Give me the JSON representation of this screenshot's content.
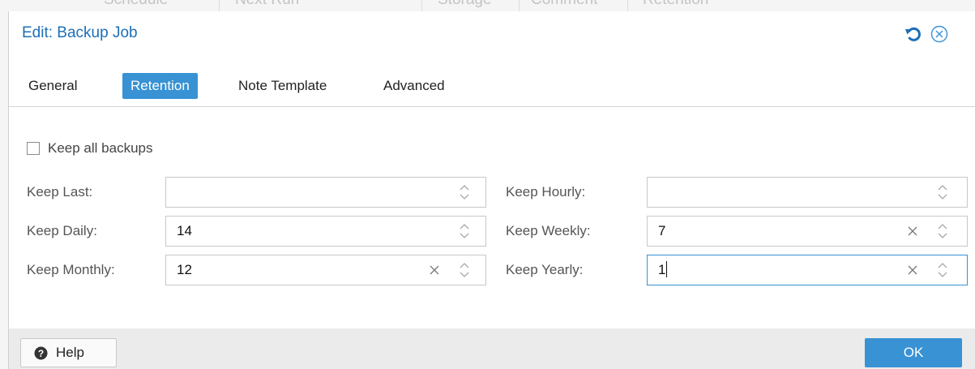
{
  "background": {
    "columns": [
      "Schedule",
      "Next Run",
      "Storage",
      "Comment",
      "Retention"
    ]
  },
  "dialog": {
    "title": "Edit: Backup Job",
    "tools": {
      "reset_icon": "reset-icon",
      "close_icon": "close-circle-icon"
    }
  },
  "tabs": [
    {
      "label": "General",
      "active": false
    },
    {
      "label": "Retention",
      "active": true
    },
    {
      "label": "Note Template",
      "active": false
    },
    {
      "label": "Advanced",
      "active": false
    }
  ],
  "retention": {
    "keep_all": {
      "label": "Keep all backups",
      "checked": false
    },
    "fields": {
      "keep_last": {
        "label": "Keep Last:",
        "value": ""
      },
      "keep_daily": {
        "label": "Keep Daily:",
        "value": "14"
      },
      "keep_monthly": {
        "label": "Keep Monthly:",
        "value": "12"
      },
      "keep_hourly": {
        "label": "Keep Hourly:",
        "value": ""
      },
      "keep_weekly": {
        "label": "Keep Weekly:",
        "value": "7"
      },
      "keep_yearly": {
        "label": "Keep Yearly:",
        "value": "1"
      }
    }
  },
  "footer": {
    "help_label": "Help",
    "ok_label": "OK"
  },
  "colors": {
    "accent": "#3892d4",
    "title": "#1d6fb8",
    "footer_bg": "#ebebeb"
  }
}
